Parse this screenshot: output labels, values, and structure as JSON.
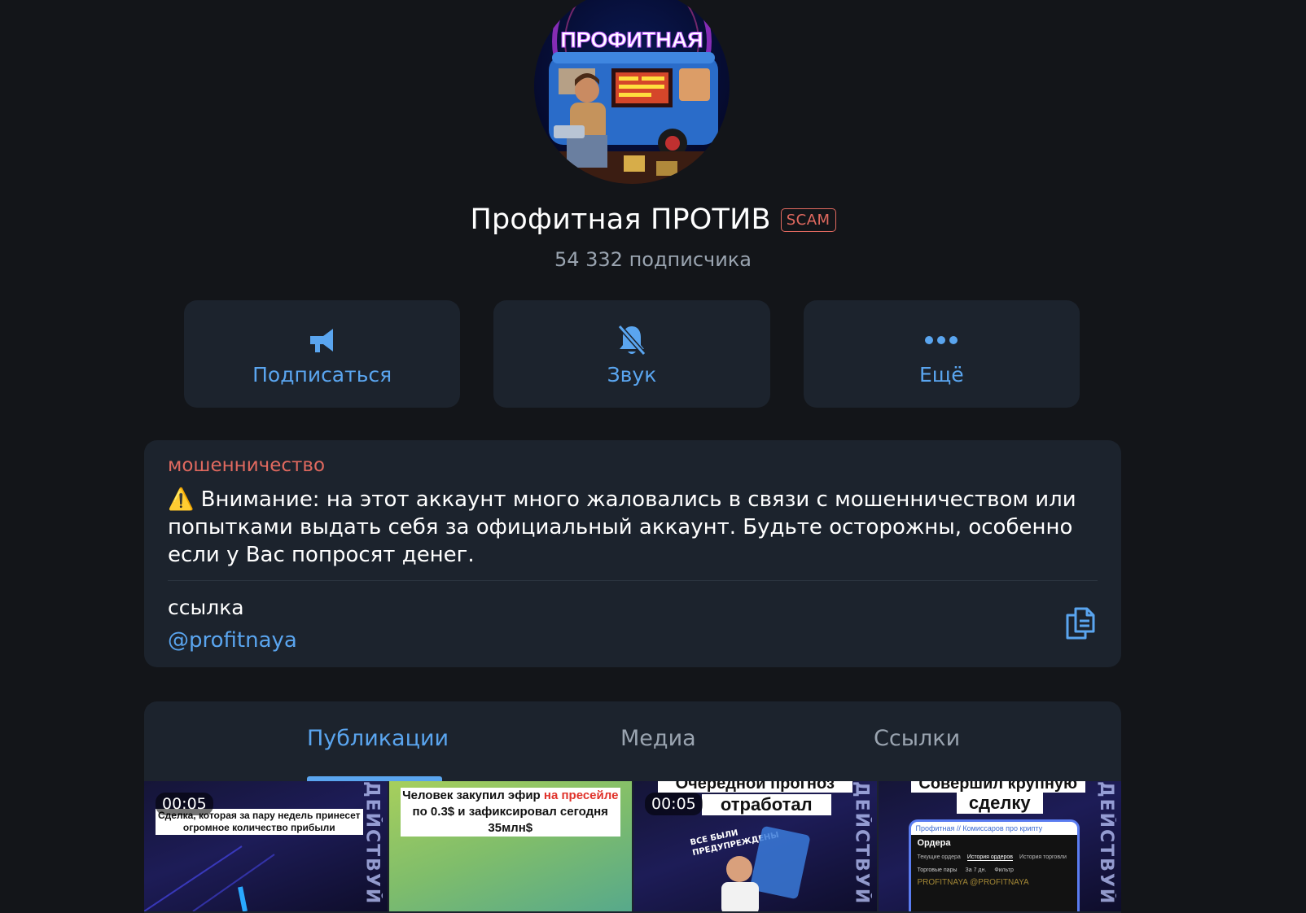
{
  "profile": {
    "avatar_text": "ПРОФИТНАЯ",
    "name": "Профитная ПРОТИВ",
    "badge": "SCAM",
    "subscribers": "54 332 подписчика"
  },
  "actions": [
    {
      "label": "Подписаться",
      "icon": "megaphone-icon"
    },
    {
      "label": "Звук",
      "icon": "bell-muted-icon"
    },
    {
      "label": "Ещё",
      "icon": "more-icon"
    }
  ],
  "info": {
    "warning_label": "мошенничество",
    "warning_text": "⚠️ Внимание: на этот аккаунт много жаловались в связи с мошенничеством или попытками выдать себя за официальный аккаунт. Будьте осторожны, особенно если у Вас попросят денег.",
    "link_label": "ссылка",
    "link_value": "@profitnaya"
  },
  "tabs": [
    {
      "label": "Публикации",
      "active": true
    },
    {
      "label": "Медиа",
      "active": false
    },
    {
      "label": "Ссылки",
      "active": false
    }
  ],
  "media": [
    {
      "duration": "00:05",
      "caption": "Сделка, которая за пару недель принесет огромное количество прибыли",
      "side_text": "ДЕЙСТВУЙ"
    },
    {
      "caption_part1": "Человек закупил эфир ",
      "caption_red1": "на",
      "caption_red2": "пресейле",
      "caption_part2": " по 0.3$ и зафиксировал сегодня 35млн$"
    },
    {
      "duration": "00:05",
      "caption_top": "Очередной прогноз",
      "caption": "отработал",
      "sticker": "ВСЕ БЫЛИ ПРЕДУПРЕЖДЕНЫ",
      "side_text": "ДЕЙСТВУЙ"
    },
    {
      "caption_top": "Совершил крупную",
      "caption": "сделку",
      "screen_title": "Профитная // Комиссаров про крипту",
      "screen_heading": "Ордера",
      "screen_tabs": [
        "Текущие ордера",
        "История ордеров",
        "История торговли"
      ],
      "screen_filters": [
        "Торговые пары",
        "За 7 дн.",
        "Фильтр"
      ],
      "watermark": "PROFITNAYA  @PROFITNAYA",
      "side_text": "ДЕЙСТВУЙ"
    }
  ],
  "colors": {
    "accent": "#5aa5ef",
    "danger": "#e0695f",
    "card": "#1c232d",
    "background": "#131519"
  }
}
